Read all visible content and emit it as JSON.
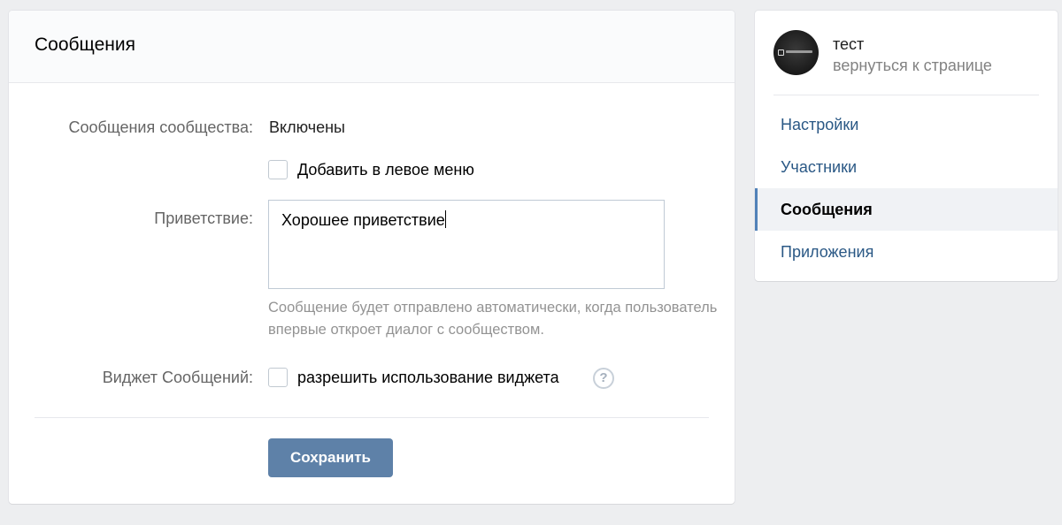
{
  "main": {
    "title": "Сообщения",
    "community_messages": {
      "label": "Сообщения сообщества:",
      "value": "Включены"
    },
    "left_menu_checkbox": {
      "label": "Добавить в левое меню",
      "checked": false
    },
    "greeting": {
      "label": "Приветствие:",
      "value": "Хорошее приветствие",
      "hint": "Сообщение будет отправлено автоматически, когда пользователь впервые откроет диалог с сообществом."
    },
    "widget": {
      "label": "Виджет Сообщений:",
      "checkbox_label": "разрешить использование виджета",
      "checked": false,
      "help": "?"
    },
    "save_label": "Сохранить"
  },
  "sidebar": {
    "community_name": "тест",
    "back_link": "вернуться к странице",
    "items": [
      {
        "label": "Настройки",
        "active": false
      },
      {
        "label": "Участники",
        "active": false
      },
      {
        "label": "Сообщения",
        "active": true
      },
      {
        "label": "Приложения",
        "active": false
      }
    ]
  },
  "colors": {
    "accent": "#5181b8",
    "button": "#5e81a8",
    "link": "#2a5885",
    "background": "#edeef0"
  }
}
